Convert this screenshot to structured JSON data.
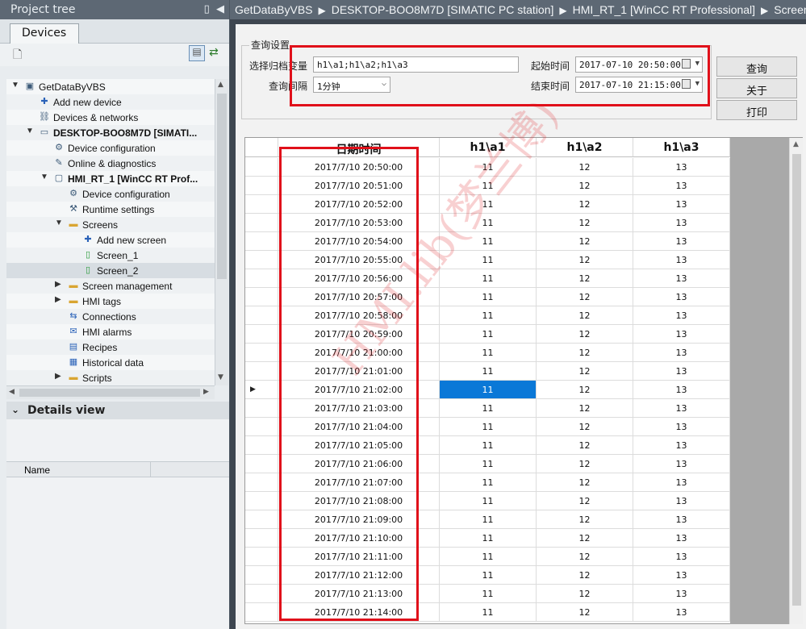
{
  "project_tree": {
    "title": "Project tree",
    "tab": "Devices",
    "items": [
      {
        "label": "GetDataByVBS",
        "icon": "project-icon",
        "indent": 0,
        "arrow": "▼"
      },
      {
        "label": "Add new device",
        "icon": "add-device-icon",
        "indent": 1,
        "arrow": ""
      },
      {
        "label": "Devices & networks",
        "icon": "network-icon",
        "indent": 1,
        "arrow": ""
      },
      {
        "label": "DESKTOP-BOO8M7D [SIMATI...",
        "icon": "pc-station-icon",
        "indent": 1,
        "arrow": "▼",
        "bold": true
      },
      {
        "label": "Device configuration",
        "icon": "device-config-icon",
        "indent": 2,
        "arrow": ""
      },
      {
        "label": "Online & diagnostics",
        "icon": "diagnostics-icon",
        "indent": 2,
        "arrow": ""
      },
      {
        "label": "HMI_RT_1 [WinCC RT Prof...",
        "icon": "hmi-runtime-icon",
        "indent": 2,
        "arrow": "▼",
        "bold": true
      },
      {
        "label": "Device configuration",
        "icon": "device-config-icon",
        "indent": 3,
        "arrow": ""
      },
      {
        "label": "Runtime settings",
        "icon": "runtime-settings-icon",
        "indent": 3,
        "arrow": ""
      },
      {
        "label": "Screens",
        "icon": "folder-icon",
        "indent": 3,
        "arrow": "▼"
      },
      {
        "label": "Add new screen",
        "icon": "add-screen-icon",
        "indent": 4,
        "arrow": ""
      },
      {
        "label": "Screen_1",
        "icon": "screen-icon",
        "indent": 4,
        "arrow": ""
      },
      {
        "label": "Screen_2",
        "icon": "screen-icon",
        "indent": 4,
        "arrow": "",
        "selected": true
      },
      {
        "label": "Screen management",
        "icon": "folder-icon",
        "indent": 3,
        "arrow": "▶"
      },
      {
        "label": "HMI tags",
        "icon": "folder-icon",
        "indent": 3,
        "arrow": "▶"
      },
      {
        "label": "Connections",
        "icon": "connections-icon",
        "indent": 3,
        "arrow": ""
      },
      {
        "label": "HMI alarms",
        "icon": "alarms-icon",
        "indent": 3,
        "arrow": ""
      },
      {
        "label": "Recipes",
        "icon": "recipes-icon",
        "indent": 3,
        "arrow": ""
      },
      {
        "label": "Historical data",
        "icon": "historical-data-icon",
        "indent": 3,
        "arrow": ""
      },
      {
        "label": "Scripts",
        "icon": "folder-icon",
        "indent": 3,
        "arrow": "▶"
      }
    ]
  },
  "details_view": {
    "title": "Details view",
    "column_name": "Name"
  },
  "breadcrumb": [
    "GetDataByVBS",
    "DESKTOP-BOO8M7D [SIMATIC PC station]",
    "HMI_RT_1 [WinCC RT Professional]",
    "Screens"
  ],
  "query": {
    "group_title": "查询设置",
    "archive_label": "选择归档变量",
    "archive_value": "h1\\a1;h1\\a2;h1\\a3",
    "interval_label": "查询间隔",
    "interval_value": "1分钟",
    "start_label": "起始时间",
    "start_value": "2017-07-10  20:50:00",
    "end_label": "结束时间",
    "end_value": "2017-07-10  21:15:00",
    "btn_query": "查询",
    "btn_close": "关于",
    "btn_print": "打印"
  },
  "table": {
    "columns": [
      "日期时间",
      "h1\\a1",
      "h1\\a2",
      "h1\\a3"
    ],
    "rows": [
      [
        "2017/7/10  20:50:00",
        "11",
        "12",
        "13"
      ],
      [
        "2017/7/10  20:51:00",
        "11",
        "12",
        "13"
      ],
      [
        "2017/7/10  20:52:00",
        "11",
        "12",
        "13"
      ],
      [
        "2017/7/10  20:53:00",
        "11",
        "12",
        "13"
      ],
      [
        "2017/7/10  20:54:00",
        "11",
        "12",
        "13"
      ],
      [
        "2017/7/10  20:55:00",
        "11",
        "12",
        "13"
      ],
      [
        "2017/7/10  20:56:00",
        "11",
        "12",
        "13"
      ],
      [
        "2017/7/10  20:57:00",
        "11",
        "12",
        "13"
      ],
      [
        "2017/7/10  20:58:00",
        "11",
        "12",
        "13"
      ],
      [
        "2017/7/10  20:59:00",
        "11",
        "12",
        "13"
      ],
      [
        "2017/7/10  21:00:00",
        "11",
        "12",
        "13"
      ],
      [
        "2017/7/10  21:01:00",
        "11",
        "12",
        "13"
      ],
      [
        "2017/7/10  21:02:00",
        "11",
        "12",
        "13"
      ],
      [
        "2017/7/10  21:03:00",
        "11",
        "12",
        "13"
      ],
      [
        "2017/7/10  21:04:00",
        "11",
        "12",
        "13"
      ],
      [
        "2017/7/10  21:05:00",
        "11",
        "12",
        "13"
      ],
      [
        "2017/7/10  21:06:00",
        "11",
        "12",
        "13"
      ],
      [
        "2017/7/10  21:07:00",
        "11",
        "12",
        "13"
      ],
      [
        "2017/7/10  21:08:00",
        "11",
        "12",
        "13"
      ],
      [
        "2017/7/10  21:09:00",
        "11",
        "12",
        "13"
      ],
      [
        "2017/7/10  21:10:00",
        "11",
        "12",
        "13"
      ],
      [
        "2017/7/10  21:11:00",
        "11",
        "12",
        "13"
      ],
      [
        "2017/7/10  21:12:00",
        "11",
        "12",
        "13"
      ],
      [
        "2017/7/10  21:13:00",
        "11",
        "12",
        "13"
      ],
      [
        "2017/7/10  21:14:00",
        "11",
        "12",
        "13"
      ]
    ],
    "current_row_marker": "▶",
    "current_row": 12,
    "selected_cell": {
      "row": 12,
      "col": 1
    }
  },
  "watermark": "HMI.lib(梦兰博)",
  "colors": {
    "highlight_red": "#e0101a",
    "selection_blue": "#0a78d7"
  }
}
